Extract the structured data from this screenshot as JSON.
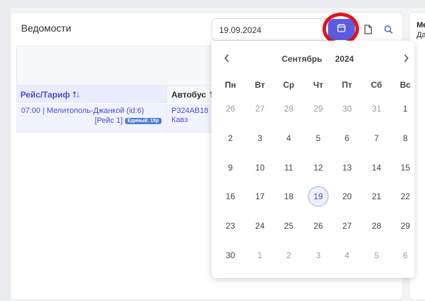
{
  "panel": {
    "title": "Ведомости"
  },
  "date_input": {
    "value": "19.09.2024"
  },
  "table": {
    "headers": [
      {
        "label": "Рейс/Тариф",
        "sort_icon": "sort-icon"
      },
      {
        "label": "Автобус",
        "sort_icon": "sort-icon"
      }
    ],
    "rows": [
      {
        "route": "07:00 | Мелитополь-Джанкой (id:6)",
        "trip": "[Рейс 1]",
        "badge": "Единый: 15р",
        "bus_number": "Р324АВ18",
        "bus_model": "Кавз"
      }
    ]
  },
  "right_panel": {
    "line1": "Ме",
    "line2": "Да"
  },
  "calendar": {
    "month": "Сентябрь",
    "year": "2024",
    "prev_icon": "chevron-left-icon",
    "next_icon": "chevron-right-icon",
    "weekdays": [
      "Пн",
      "Вт",
      "Ср",
      "Чт",
      "Пт",
      "Сб",
      "Вс"
    ],
    "weeks": [
      [
        "26",
        "27",
        "28",
        "29",
        "30",
        "31",
        "1"
      ],
      [
        "2",
        "3",
        "4",
        "5",
        "6",
        "7",
        "8"
      ],
      [
        "9",
        "10",
        "11",
        "12",
        "13",
        "14",
        "15"
      ],
      [
        "16",
        "17",
        "18",
        "19",
        "20",
        "21",
        "22"
      ],
      [
        "23",
        "24",
        "25",
        "26",
        "27",
        "28",
        "29"
      ],
      [
        "30",
        "1",
        "2",
        "3",
        "4",
        "5",
        "6"
      ]
    ],
    "other_month": [
      [
        true,
        true,
        true,
        true,
        true,
        true,
        false
      ],
      [
        false,
        false,
        false,
        false,
        false,
        false,
        false
      ],
      [
        false,
        false,
        false,
        false,
        false,
        false,
        false
      ],
      [
        false,
        false,
        false,
        false,
        false,
        false,
        false
      ],
      [
        false,
        false,
        false,
        false,
        false,
        false,
        false
      ],
      [
        false,
        true,
        true,
        true,
        true,
        true,
        true
      ]
    ],
    "selected": "19"
  },
  "toolbar": {
    "calendar_icon": "calendar-icon",
    "file_icon": "file-icon",
    "search_icon": "search-icon"
  },
  "colors": {
    "accent": "#5b5ce0",
    "highlight_ring": "#e4141b",
    "link": "#4a4ecb",
    "badge": "#4d7dd6"
  }
}
